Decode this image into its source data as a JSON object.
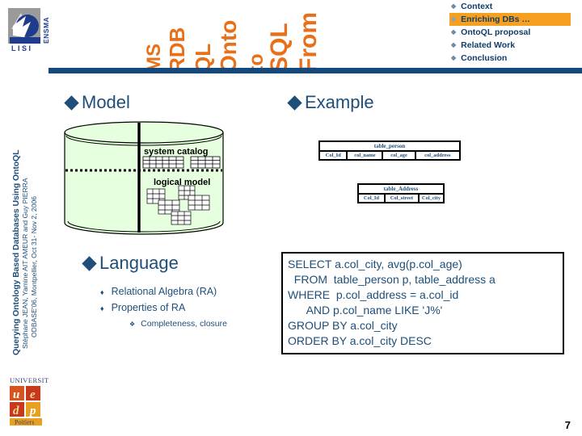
{
  "slide": {
    "page_number": "7",
    "colors": {
      "navy": "#13497C",
      "title_orange": "#E8701A",
      "highlight_orange": "#F5A01E",
      "text_blue": "#1E4E79",
      "cylinder_green": "#E6FFDE"
    }
  },
  "title": {
    "full": "From SQL to OntoQL RDBMS",
    "words": [
      "From",
      "SQL",
      "to",
      "Onto",
      "QL",
      "RDB",
      "MS"
    ]
  },
  "agenda": {
    "items": [
      {
        "label": "Context",
        "active": false
      },
      {
        "label": "Enriching DBs …",
        "active": true
      },
      {
        "label": "OntoQL proposal",
        "active": false
      },
      {
        "label": "Related Work",
        "active": false
      },
      {
        "label": "Conclusion",
        "active": false
      }
    ]
  },
  "sidebar": {
    "title": "Querying Ontology Based Databases Using OntoQL",
    "authors": "Stéphane JEAN, Yamine AIT AMEUR and Guy PIERRA",
    "venue": "ODBASE'06, Montpellier, Oct 31- Nov 2, 2006"
  },
  "sections": {
    "model": {
      "heading": "Model",
      "system_catalog_label": "system catalog",
      "logical_model_label": "logical model"
    },
    "example": {
      "heading": "Example",
      "tables": [
        {
          "name": "table_person",
          "columns": [
            "Col_Id",
            "col_name",
            "col_age",
            "col_address"
          ]
        },
        {
          "name": "table_Address",
          "columns": [
            "Col_Id",
            "Col_street",
            "Col_city"
          ]
        }
      ],
      "query_lines": [
        "SELECT a.col_city, avg(p.col_age)",
        "  FROM  table_person p, table_address a",
        "WHERE  p.col_address = a.col_id",
        "      AND p.col_name LIKE 'J%'",
        "GROUP BY a.col_city",
        "ORDER BY a.col_city DESC"
      ]
    },
    "language": {
      "heading": "Language",
      "bullets": [
        "Relational Algebra (RA)",
        "Properties of RA"
      ],
      "sub_bullets": [
        "Completeness, closure"
      ]
    }
  },
  "logos": {
    "top_left": {
      "primary": "LISI",
      "secondary": "ENSMA"
    },
    "bottom_left": {
      "line1": "UNIVERSITÉ",
      "line2": "Poitiers"
    }
  }
}
